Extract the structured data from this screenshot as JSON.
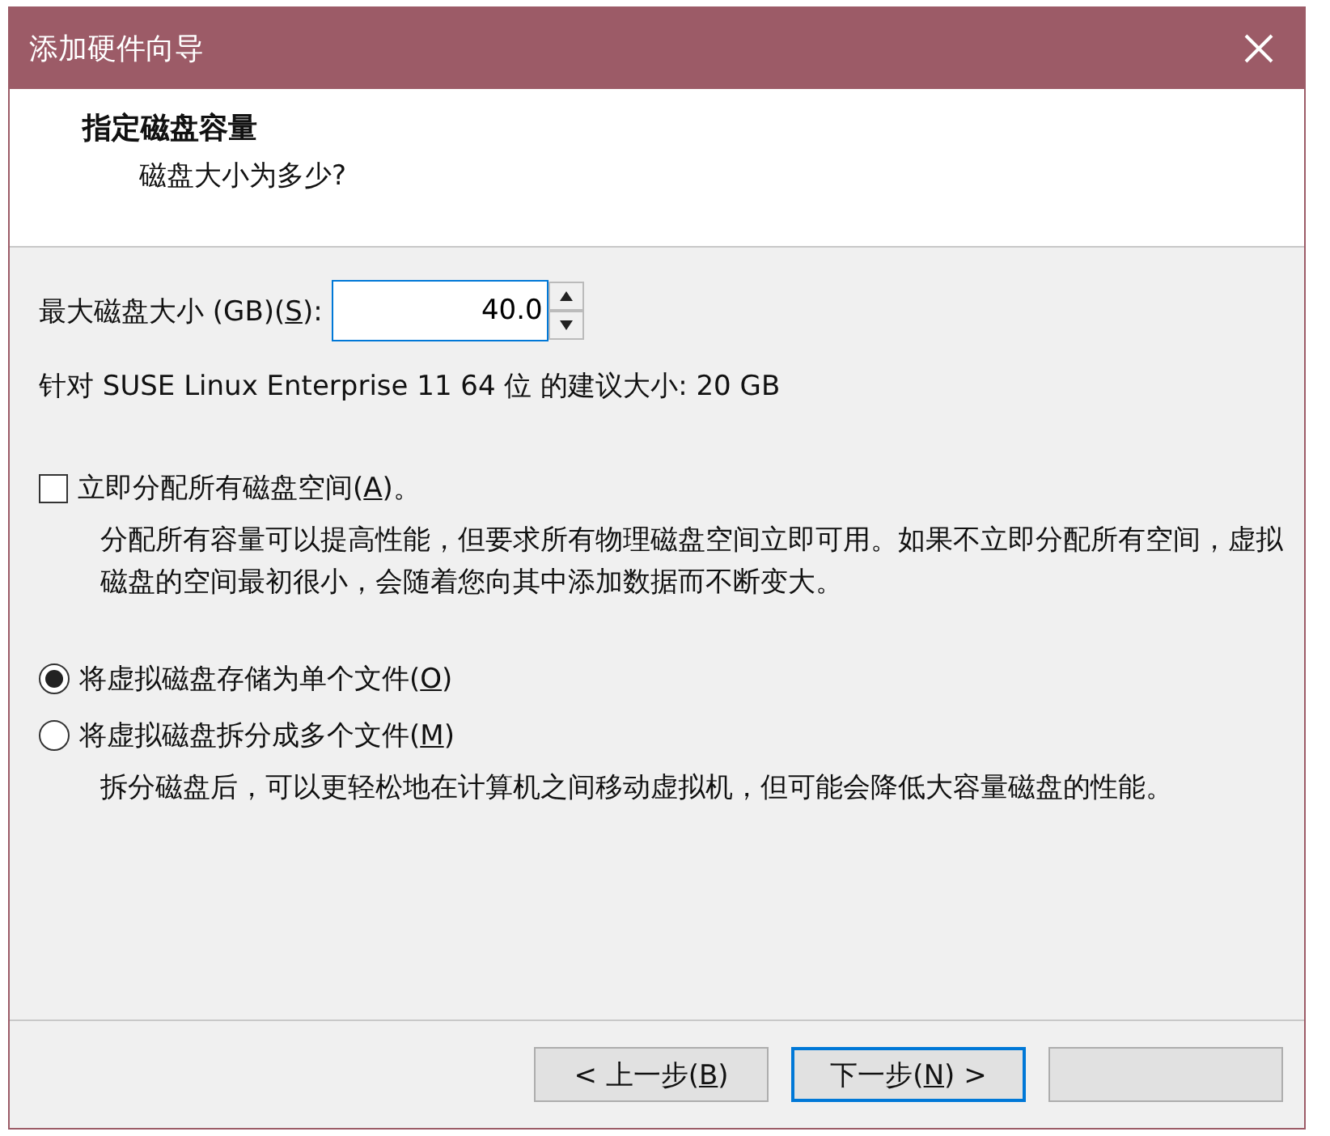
{
  "window": {
    "title": "添加硬件向导"
  },
  "header": {
    "title": "指定磁盘容量",
    "subtitle": "磁盘大小为多少?"
  },
  "size_field": {
    "label": {
      "text": "最大磁盘大小 (GB)(",
      "key": "S",
      "after": "):"
    },
    "value": "40.0"
  },
  "recommendation": "针对 SUSE Linux Enterprise 11 64 位 的建议大小: 20 GB",
  "allocate": {
    "label": {
      "text": "立即分配所有磁盘空间(",
      "key": "A",
      "after": ")。"
    },
    "checked": false,
    "description": "分配所有容量可以提高性能，但要求所有物理磁盘空间立即可用。如果不立即分配所有空间，虚拟磁盘的空间最初很小，会随着您向其中添加数据而不断变大。"
  },
  "storage_options": [
    {
      "label": {
        "text": "将虚拟磁盘存储为单个文件(",
        "key": "O",
        "after": ")"
      },
      "selected": true
    },
    {
      "label": {
        "text": "将虚拟磁盘拆分成多个文件(",
        "key": "M",
        "after": ")"
      },
      "selected": false,
      "description": "拆分磁盘后，可以更轻松地在计算机之间移动虚拟机，但可能会降低大容量磁盘的性能。"
    }
  ],
  "buttons": [
    {
      "kind": "back",
      "label": {
        "text": "< 上一步(",
        "key": "B",
        "after": ")"
      }
    },
    {
      "kind": "next",
      "label": {
        "text": "下一步(",
        "key": "N",
        "after": ") >"
      }
    },
    {
      "kind": "blank"
    }
  ]
}
